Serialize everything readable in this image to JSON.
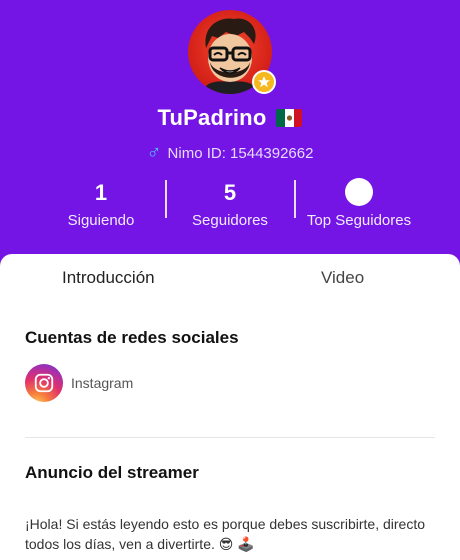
{
  "profile": {
    "name": "TuPadrino",
    "id_text": "Nimo ID: 1544392662",
    "flag_colors": [
      "#006847",
      "#ffffff",
      "#ce1126"
    ],
    "gender_icon": "male-icon"
  },
  "stats": [
    {
      "value": "1",
      "label": "Siguiendo"
    },
    {
      "value": "5",
      "label": "Seguidores"
    },
    {
      "value": "",
      "label": "Top Seguidores"
    }
  ],
  "tabs": [
    {
      "label": "Introducción"
    },
    {
      "label": "Video"
    }
  ],
  "social": {
    "title": "Cuentas de redes sociales",
    "items": [
      {
        "label": "Instagram",
        "icon": "instagram-icon"
      }
    ]
  },
  "announcement": {
    "title": "Anuncio del streamer",
    "text": "¡Hola! Si estás leyendo esto es porque debes suscribirte, directo todos los días, ven a divertirte. 😎 🕹️"
  },
  "colors": {
    "header_bg": "#7415e6",
    "avatar_bg": "#d8241b",
    "badge": "#f5b81f"
  }
}
